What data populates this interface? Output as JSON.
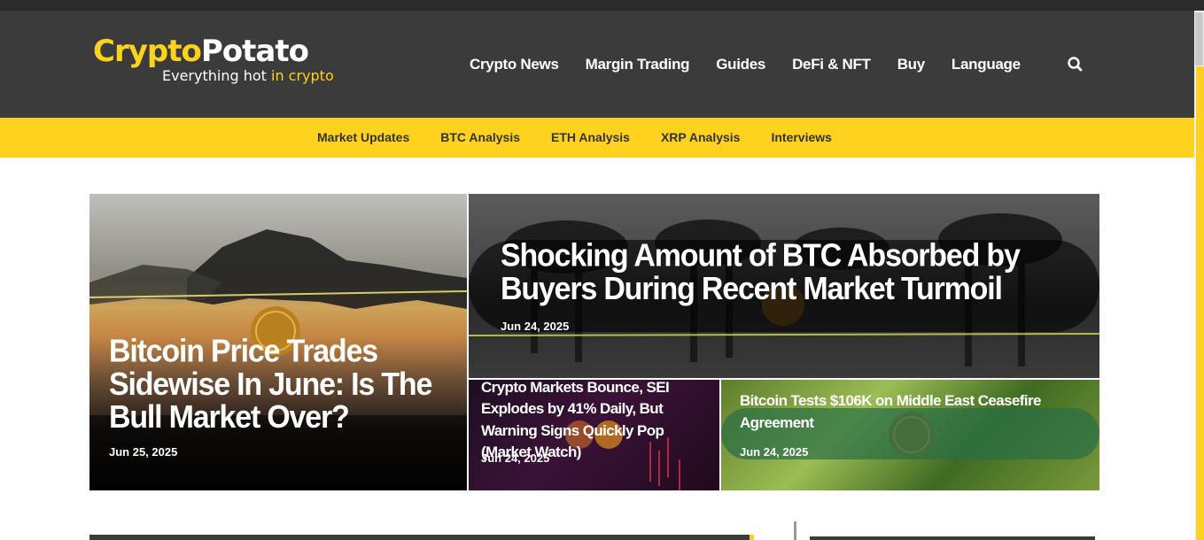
{
  "logo": {
    "name_part1": "Crypto",
    "name_part2": "Potato",
    "tagline_part1": "Everything hot ",
    "tagline_part2": "in crypto"
  },
  "main_nav": [
    {
      "label": "Crypto News"
    },
    {
      "label": "Margin Trading"
    },
    {
      "label": "Guides"
    },
    {
      "label": "DeFi & NFT"
    },
    {
      "label": "Buy"
    },
    {
      "label": "Language"
    }
  ],
  "sub_nav": [
    {
      "label": "Market Updates"
    },
    {
      "label": "BTC Analysis"
    },
    {
      "label": "ETH Analysis"
    },
    {
      "label": "XRP Analysis"
    },
    {
      "label": "Interviews"
    }
  ],
  "featured": [
    {
      "title": "Bitcoin Price Trades Sidewise In June: Is The Bull Market Over?",
      "date": "Jun 25, 2025"
    },
    {
      "title": "Shocking Amount of BTC Absorbed by Buyers During Recent Market Turmoil",
      "date": "Jun 24, 2025"
    },
    {
      "title": "Crypto Markets Bounce, SEI Explodes by 41% Daily, But Warning Signs Quickly Pop (Market Watch)",
      "date": "Jun 24, 2025"
    },
    {
      "title": "Bitcoin Tests $106K on Middle East Ceasefire Agreement",
      "date": "Jun 24, 2025"
    }
  ],
  "colors": {
    "brand_yellow": "#ffd21f",
    "header_dark": "#3b3b3b"
  },
  "icons": {
    "search": "search-icon",
    "coin": "bitcoin-coin-icon"
  }
}
